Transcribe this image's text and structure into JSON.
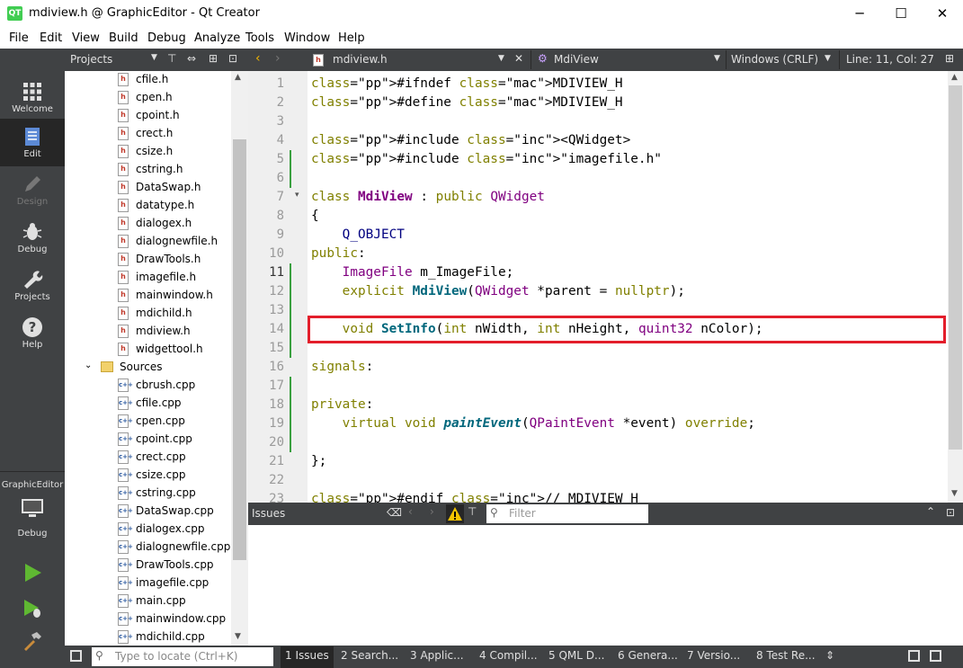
{
  "window": {
    "title": "mdiview.h @ GraphicEditor - Qt Creator",
    "app_icon": "QT",
    "minimize": "─",
    "maximize": "☐",
    "close": "✕"
  },
  "menu": [
    "File",
    "Edit",
    "View",
    "Build",
    "Debug",
    "Analyze",
    "Tools",
    "Window",
    "Help"
  ],
  "modes": [
    {
      "label": "Welcome",
      "icon": "grid-icon"
    },
    {
      "label": "Edit",
      "icon": "document-icon"
    },
    {
      "label": "Design",
      "icon": "pencil-icon"
    },
    {
      "label": "Debug",
      "icon": "bug-icon"
    },
    {
      "label": "Projects",
      "icon": "wrench-icon"
    },
    {
      "label": "Help",
      "icon": "question-icon"
    }
  ],
  "kit": {
    "project": "GraphicEditor",
    "mode": "Debug"
  },
  "projects": {
    "title": "Projects",
    "headers": [
      "cfile.h",
      "cpen.h",
      "cpoint.h",
      "crect.h",
      "csize.h",
      "cstring.h",
      "DataSwap.h",
      "datatype.h",
      "dialogex.h",
      "dialognewfile.h",
      "DrawTools.h",
      "imagefile.h",
      "mainwindow.h",
      "mdichild.h",
      "mdiview.h",
      "widgettool.h"
    ],
    "sources_label": "Sources",
    "sources": [
      "cbrush.cpp",
      "cfile.cpp",
      "cpen.cpp",
      "cpoint.cpp",
      "crect.cpp",
      "csize.cpp",
      "cstring.cpp",
      "DataSwap.cpp",
      "dialogex.cpp",
      "dialognewfile.cpp",
      "DrawTools.cpp",
      "imagefile.cpp",
      "main.cpp",
      "mainwindow.cpp",
      "mdichild.cpp"
    ]
  },
  "editor": {
    "file": "mdiview.h",
    "symbol": "MdiView",
    "line_ending": "Windows (CRLF)",
    "position": "Line: 11, Col: 27",
    "line_numbers": [
      "1",
      "2",
      "3",
      "4",
      "5",
      "6",
      "7",
      "8",
      "9",
      "10",
      "11",
      "12",
      "13",
      "14",
      "15",
      "16",
      "17",
      "18",
      "19",
      "20",
      "21",
      "22",
      "23"
    ],
    "lines": [
      "#ifndef MDIVIEW_H",
      "#define MDIVIEW_H",
      "",
      "#include <QWidget>",
      "#include \"imagefile.h\"",
      "",
      "class MdiView : public QWidget",
      "{",
      "    Q_OBJECT",
      "public:",
      "    ImageFile m_ImageFile;",
      "    explicit MdiView(QWidget *parent = nullptr);",
      "",
      "    void SetInfo(int nWidth, int nHeight, quint32 nColor);",
      "",
      "signals:",
      "",
      "private:",
      "    virtual void paintEvent(QPaintEvent *event) override;",
      "",
      "};",
      "",
      "#endif // MDIVIEW_H"
    ]
  },
  "issues": {
    "title": "Issues",
    "filter_placeholder": "Filter"
  },
  "status": {
    "locate_placeholder": "Type to locate (Ctrl+K)",
    "tabs": [
      "1  Issues",
      "2  Search...",
      "3  Applic...",
      "4  Compil...",
      "5  QML D...",
      "6  Genera...",
      "7  Versio...",
      "8  Test Re..."
    ]
  }
}
